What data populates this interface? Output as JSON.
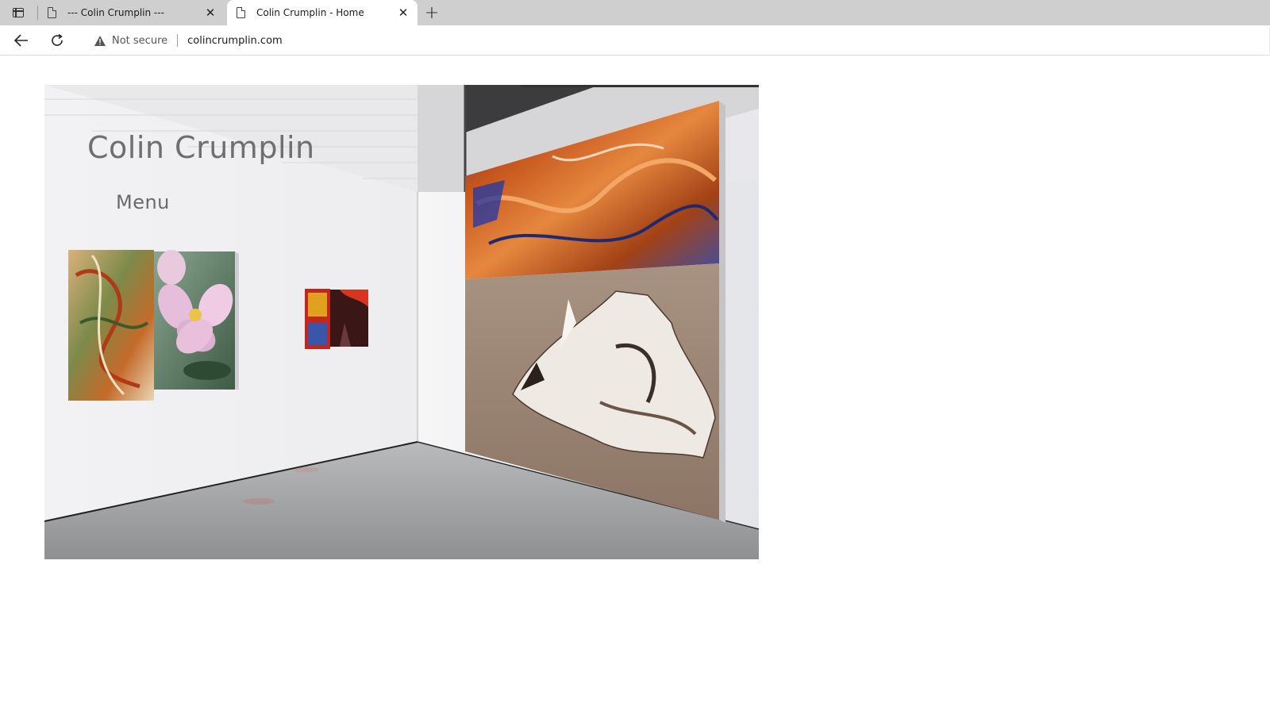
{
  "browser": {
    "tabs": [
      {
        "title": "--- Colin Crumplin ---",
        "active": false
      },
      {
        "title": "Colin Crumplin - Home",
        "active": true
      }
    ],
    "security_label": "Not secure",
    "url": "colincrumplin.com"
  },
  "page": {
    "site_title": "Colin Crumplin",
    "menu_label": "Menu"
  },
  "icons": {
    "tab_actions": "tab-actions-icon",
    "page": "page-icon",
    "close": "close-icon",
    "new_tab": "plus-icon",
    "back": "back-arrow-icon",
    "reload": "reload-icon",
    "warning": "warning-triangle-icon"
  }
}
